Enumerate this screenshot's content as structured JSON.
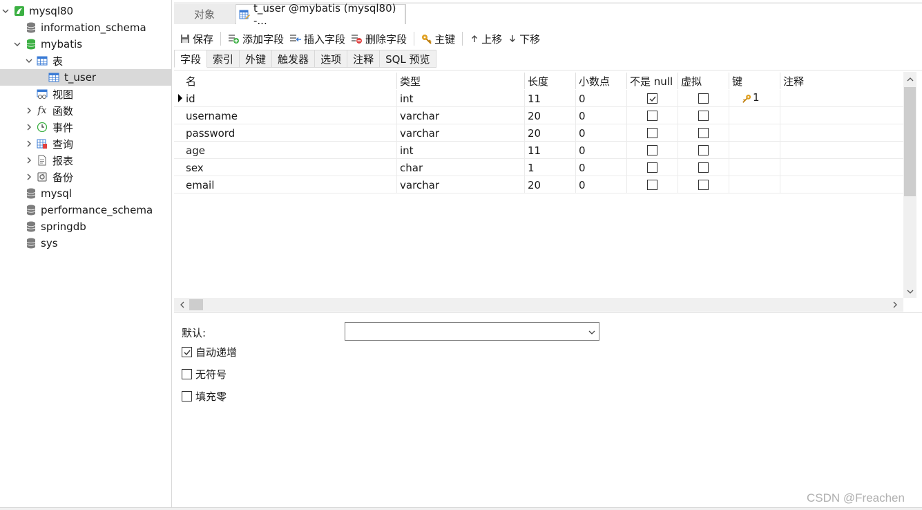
{
  "sidebar": {
    "connection": "mysql80",
    "databases": {
      "information_schema": "information_schema",
      "mybatis": "mybatis",
      "mysql": "mysql",
      "performance_schema": "performance_schema",
      "springdb": "springdb",
      "sys": "sys"
    },
    "mybatis_children": {
      "tables": "表",
      "table_t_user": "t_user",
      "views": "视图",
      "functions": "函数",
      "events": "事件",
      "queries": "查询",
      "reports": "报表",
      "backups": "备份"
    }
  },
  "tabs": {
    "objects": "对象",
    "active": "t_user @mybatis (mysql80) -..."
  },
  "toolbar": {
    "save": "保存",
    "add_field": "添加字段",
    "insert_field": "插入字段",
    "delete_field": "删除字段",
    "primary_key": "主键",
    "move_up": "上移",
    "move_down": "下移"
  },
  "subtabs": [
    "字段",
    "索引",
    "外键",
    "触发器",
    "选项",
    "注释",
    "SQL 预览"
  ],
  "grid": {
    "columns": [
      "名",
      "类型",
      "长度",
      "小数点",
      "不是 null",
      "虚拟",
      "键",
      "注释"
    ],
    "rows": [
      {
        "name": "id",
        "type": "int",
        "length": "11",
        "decimals": "0",
        "not_null": true,
        "virtual": false,
        "key": "1"
      },
      {
        "name": "username",
        "type": "varchar",
        "length": "20",
        "decimals": "0",
        "not_null": false,
        "virtual": false,
        "key": ""
      },
      {
        "name": "password",
        "type": "varchar",
        "length": "20",
        "decimals": "0",
        "not_null": false,
        "virtual": false,
        "key": ""
      },
      {
        "name": "age",
        "type": "int",
        "length": "11",
        "decimals": "0",
        "not_null": false,
        "virtual": false,
        "key": ""
      },
      {
        "name": "sex",
        "type": "char",
        "length": "1",
        "decimals": "0",
        "not_null": false,
        "virtual": false,
        "key": ""
      },
      {
        "name": "email",
        "type": "varchar",
        "length": "20",
        "decimals": "0",
        "not_null": false,
        "virtual": false,
        "key": ""
      }
    ]
  },
  "properties": {
    "default_label": "默认:",
    "default_value": "",
    "auto_increment": "自动递增",
    "auto_increment_checked": true,
    "unsigned": "无符号",
    "unsigned_checked": false,
    "zerofill": "填充零",
    "zerofill_checked": false
  },
  "watermark": "CSDN @Freachen",
  "colors": {
    "connection_icon": "#3cb043",
    "table_icon": "#3a7bd5",
    "key_icon": "#e0a020",
    "selected_row": "#d9d9d9"
  }
}
